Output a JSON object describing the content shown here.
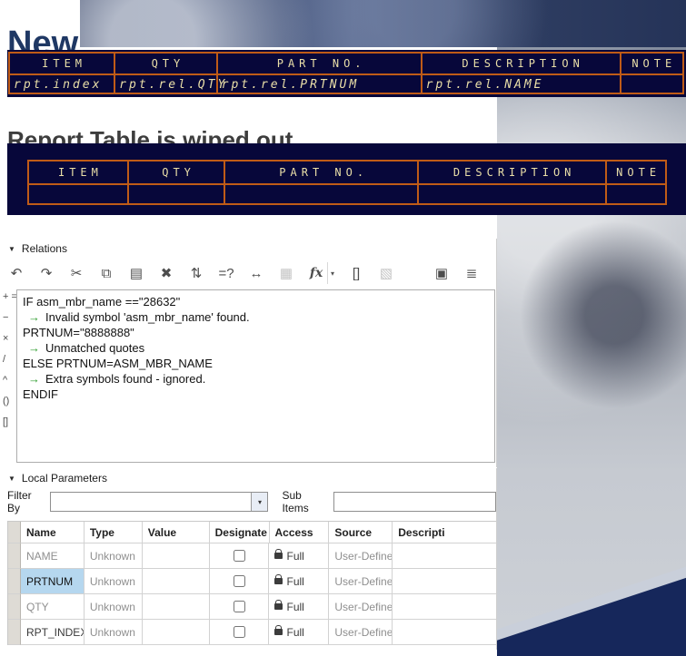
{
  "page": {
    "title_new": "New",
    "title_wiped": "Report Table is wiped out"
  },
  "colors": {
    "heading_blue": "#1f3864",
    "heading_gray": "#3d3d3d",
    "report_table_bg": "#07073a",
    "report_table_border": "#bf5b17",
    "report_table_text": "#eadfa8",
    "selected_cell_blue": "#b5d7ef",
    "message_arrow_green": "#2f9e2f",
    "swoosh_navy": "#16275b"
  },
  "report_table_new": {
    "headers": [
      "ITEM",
      "QTY",
      "PART NO.",
      "DESCRIPTION",
      "NOTE"
    ],
    "row": [
      "rpt.index",
      "rpt.rel.QTY",
      "rpt.rel.PRTNUM",
      "rpt.rel.NAME",
      ""
    ]
  },
  "report_table_wiped": {
    "headers": [
      "ITEM",
      "QTY",
      "PART NO.",
      "DESCRIPTION",
      "NOTE"
    ],
    "row": [
      "",
      "",
      "",
      "",
      ""
    ]
  },
  "relations": {
    "title": "Relations",
    "toolbar": [
      {
        "name": "undo-icon",
        "glyph": "↶",
        "enabled": true
      },
      {
        "name": "redo-icon",
        "glyph": "↷",
        "enabled": true
      },
      {
        "name": "cut-icon",
        "glyph": "✂",
        "enabled": true
      },
      {
        "name": "copy-icon",
        "glyph": "⧉",
        "enabled": true
      },
      {
        "name": "paste-icon",
        "glyph": "▤",
        "enabled": true
      },
      {
        "name": "delete-icon",
        "glyph": "✖",
        "enabled": true
      },
      {
        "name": "sort-icon",
        "glyph": "⇅",
        "enabled": true
      },
      {
        "name": "verify-icon",
        "glyph": "=?",
        "enabled": true
      },
      {
        "name": "extent-icon",
        "glyph": "↔",
        "enabled": true
      },
      {
        "name": "insert-image-icon",
        "glyph": "▦",
        "enabled": false
      },
      {
        "name": "function-icon",
        "glyph": "fx",
        "enabled": true,
        "dropdown": true
      },
      {
        "name": "brackets-icon",
        "glyph": "[]",
        "enabled": true
      },
      {
        "name": "book-icon",
        "glyph": "▧",
        "enabled": false
      },
      {
        "name": "print-icon",
        "glyph": "▣",
        "enabled": true
      },
      {
        "name": "list-icon",
        "glyph": "≣",
        "enabled": true
      }
    ],
    "operators": [
      "+ =",
      "−",
      "×",
      "/",
      "^",
      "()",
      "[]"
    ],
    "code_lines": [
      {
        "kind": "code",
        "text": "IF asm_mbr_name ==\"28632\""
      },
      {
        "kind": "msg",
        "text": "Invalid symbol 'asm_mbr_name' found."
      },
      {
        "kind": "code",
        "text": "PRTNUM=\"8888888\""
      },
      {
        "kind": "msg",
        "text": "Unmatched quotes"
      },
      {
        "kind": "code",
        "text": "ELSE PRTNUM=ASM_MBR_NAME"
      },
      {
        "kind": "msg",
        "text": "Extra symbols found - ignored."
      },
      {
        "kind": "code",
        "text": "ENDIF"
      }
    ]
  },
  "local_parameters": {
    "title": "Local Parameters",
    "filter_by_label": "Filter By",
    "sub_items_label": "Sub Items",
    "columns": [
      "Name",
      "Type",
      "Value",
      "Designate",
      "Access",
      "Source",
      "Descripti"
    ],
    "rows": [
      {
        "name": "NAME",
        "type": "Unknown",
        "value": "",
        "designate": false,
        "access": "Full",
        "source": "User-Define",
        "selected": false,
        "muted": true
      },
      {
        "name": "PRTNUM",
        "type": "Unknown",
        "value": "",
        "designate": false,
        "access": "Full",
        "source": "User-Define",
        "selected": true,
        "muted": false
      },
      {
        "name": "QTY",
        "type": "Unknown",
        "value": "",
        "designate": false,
        "access": "Full",
        "source": "User-Define",
        "selected": false,
        "muted": true
      },
      {
        "name": "RPT_INDEX",
        "type": "Unknown",
        "value": "",
        "designate": false,
        "access": "Full",
        "source": "User-Define",
        "selected": false,
        "muted": false
      }
    ]
  }
}
